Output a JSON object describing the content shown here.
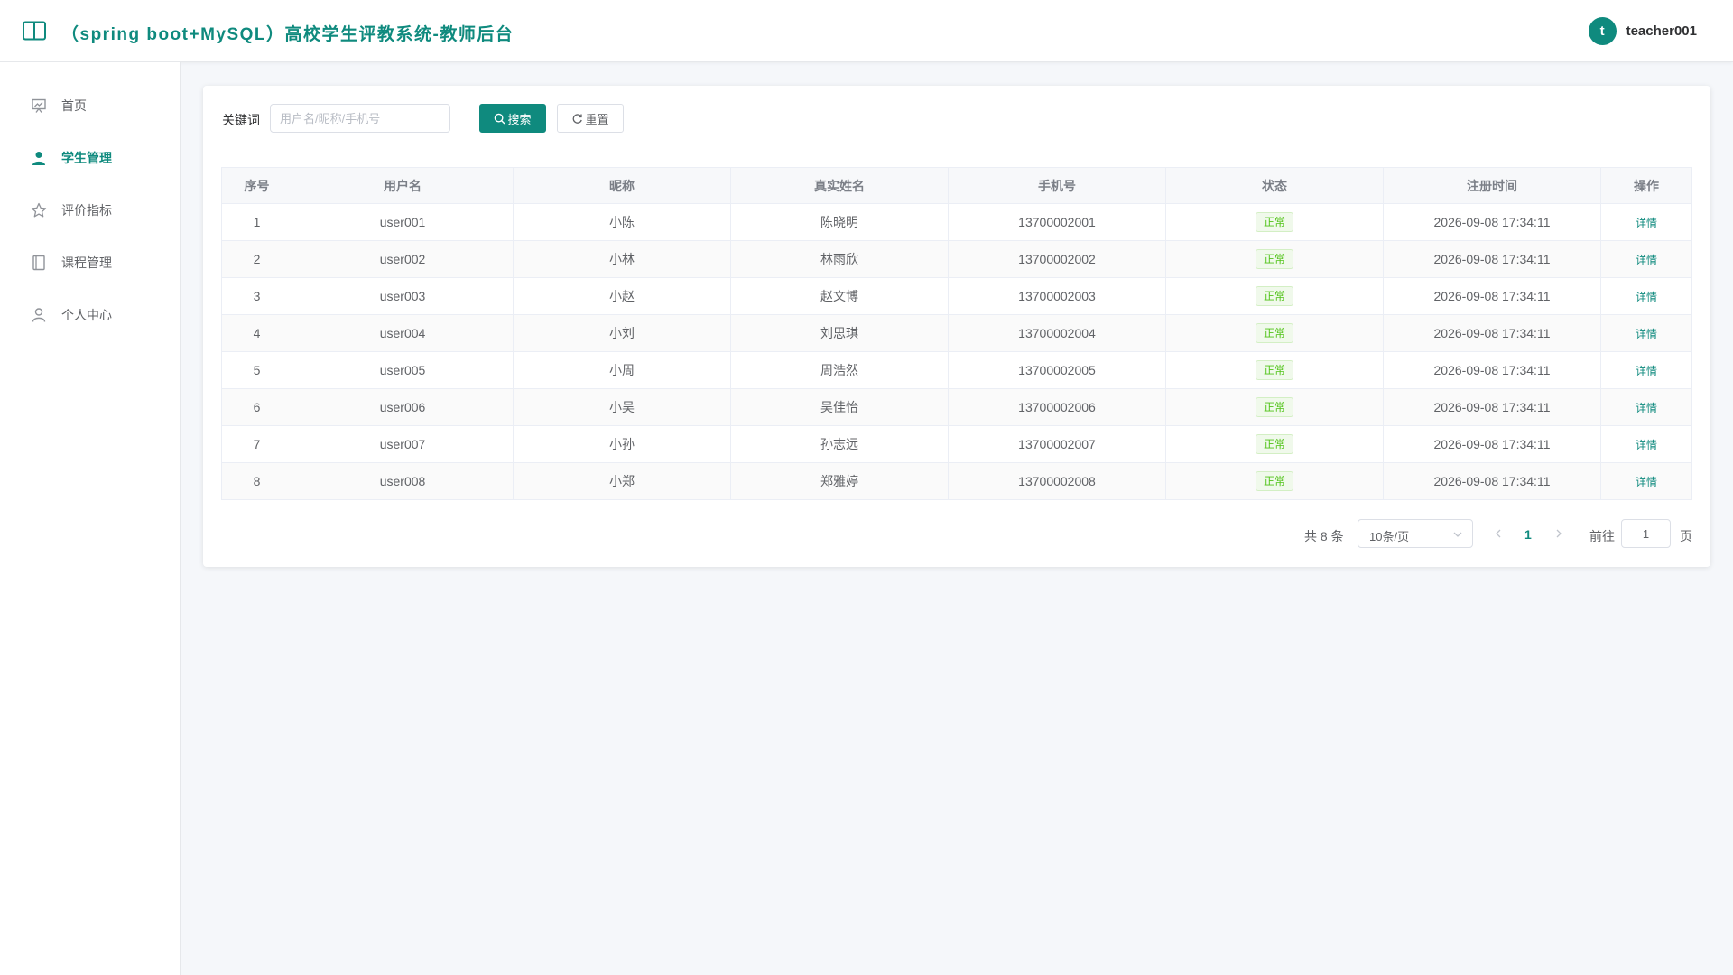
{
  "header": {
    "title": "（spring boot+MySQL）高校学生评教系统-教师后台",
    "avatar_letter": "t",
    "username": "teacher001"
  },
  "sidebar": {
    "items": [
      {
        "label": "首页",
        "icon": "presentation-icon"
      },
      {
        "label": "学生管理",
        "icon": "user-solid-icon",
        "active": true
      },
      {
        "label": "评价指标",
        "icon": "star-icon"
      },
      {
        "label": "课程管理",
        "icon": "notebook-icon"
      },
      {
        "label": "个人中心",
        "icon": "user-outline-icon"
      }
    ]
  },
  "search": {
    "label": "关键词",
    "placeholder": "用户名/昵称/手机号",
    "value": "",
    "search_button": "搜索",
    "reset_button": "重置"
  },
  "table": {
    "columns": [
      "序号",
      "用户名",
      "昵称",
      "真实姓名",
      "手机号",
      "状态",
      "注册时间",
      "操作"
    ],
    "rows": [
      {
        "idx": "1",
        "username": "user001",
        "nickname": "小陈",
        "realname": "陈晓明",
        "phone": "13700002001",
        "status": "正常",
        "created": "2026-09-08 17:34:11",
        "action": "详情"
      },
      {
        "idx": "2",
        "username": "user002",
        "nickname": "小林",
        "realname": "林雨欣",
        "phone": "13700002002",
        "status": "正常",
        "created": "2026-09-08 17:34:11",
        "action": "详情"
      },
      {
        "idx": "3",
        "username": "user003",
        "nickname": "小赵",
        "realname": "赵文博",
        "phone": "13700002003",
        "status": "正常",
        "created": "2026-09-08 17:34:11",
        "action": "详情"
      },
      {
        "idx": "4",
        "username": "user004",
        "nickname": "小刘",
        "realname": "刘思琪",
        "phone": "13700002004",
        "status": "正常",
        "created": "2026-09-08 17:34:11",
        "action": "详情"
      },
      {
        "idx": "5",
        "username": "user005",
        "nickname": "小周",
        "realname": "周浩然",
        "phone": "13700002005",
        "status": "正常",
        "created": "2026-09-08 17:34:11",
        "action": "详情"
      },
      {
        "idx": "6",
        "username": "user006",
        "nickname": "小吴",
        "realname": "吴佳怡",
        "phone": "13700002006",
        "status": "正常",
        "created": "2026-09-08 17:34:11",
        "action": "详情"
      },
      {
        "idx": "7",
        "username": "user007",
        "nickname": "小孙",
        "realname": "孙志远",
        "phone": "13700002007",
        "status": "正常",
        "created": "2026-09-08 17:34:11",
        "action": "详情"
      },
      {
        "idx": "8",
        "username": "user008",
        "nickname": "小郑",
        "realname": "郑雅婷",
        "phone": "13700002008",
        "status": "正常",
        "created": "2026-09-08 17:34:11",
        "action": "详情"
      }
    ]
  },
  "pagination": {
    "total_text": "共 8 条",
    "page_size": "10条/页",
    "current_page": "1",
    "goto_label": "前往",
    "goto_value": "1",
    "goto_suffix": "页"
  },
  "colors": {
    "primary": "#0f8a7e",
    "status_green": "#52c41a",
    "background": "#f5f7fa"
  }
}
